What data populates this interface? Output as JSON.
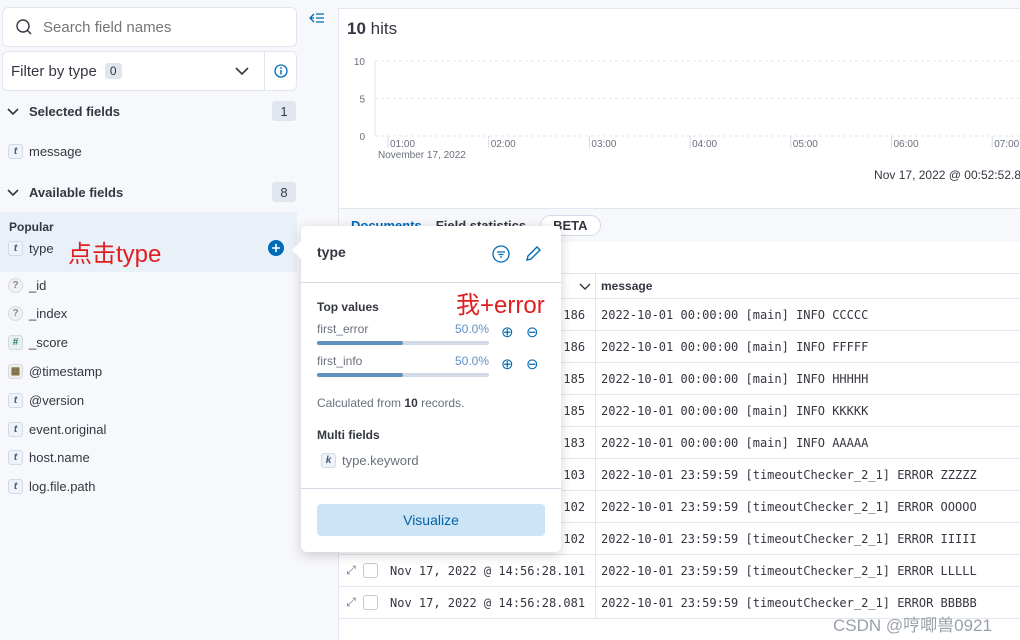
{
  "sidebar": {
    "search_placeholder": "Search field names",
    "filter_label": "Filter by type",
    "filter_count": "0",
    "selected_title": "Selected fields",
    "selected_count": "1",
    "selected_fields": [
      {
        "type": "t",
        "name": "message"
      }
    ],
    "available_title": "Available fields",
    "available_count": "8",
    "popular_title": "Popular",
    "popular_fields": [
      {
        "type": "t",
        "name": "type"
      }
    ],
    "fields": [
      {
        "type": "?",
        "name": "_id"
      },
      {
        "type": "?",
        "name": "_index"
      },
      {
        "type": "#",
        "name": "_score"
      },
      {
        "type": "date",
        "name": "@timestamp"
      },
      {
        "type": "t",
        "name": "@version"
      },
      {
        "type": "t",
        "name": "event.original"
      },
      {
        "type": "t",
        "name": "host.name"
      },
      {
        "type": "t",
        "name": "log.file.path"
      }
    ]
  },
  "annotations": {
    "click_type": "点击type",
    "me_error": "我+error"
  },
  "main": {
    "hits_count": "10",
    "hits_label": "hits",
    "chart": {
      "y_ticks": [
        "10",
        "5",
        "0"
      ],
      "x_ticks": [
        "01:00",
        "02:00",
        "03:00",
        "04:00",
        "05:00",
        "06:00",
        "07:00"
      ],
      "date_label": "November 17, 2022",
      "range_label": "Nov 17, 2022 @ 00:52:52.8"
    },
    "tabs": {
      "documents": "Documents",
      "field_stats": "Field statistics",
      "beta": "BETA"
    },
    "table": {
      "message_header": "message",
      "rows": [
        {
          "ts": "Nov 17, 2022 @ 14:56:28.186",
          "msg": "2022-10-01 00:00:00 [main] INFO CCCCC"
        },
        {
          "ts": "Nov 17, 2022 @ 14:56:28.186",
          "msg": "2022-10-01 00:00:00 [main] INFO FFFFF"
        },
        {
          "ts": "Nov 17, 2022 @ 14:56:28.185",
          "msg": "2022-10-01 00:00:00 [main] INFO HHHHH"
        },
        {
          "ts": "Nov 17, 2022 @ 14:56:28.185",
          "msg": "2022-10-01 00:00:00 [main] INFO KKKKK"
        },
        {
          "ts": "Nov 17, 2022 @ 14:56:28.183",
          "msg": "2022-10-01 00:00:00 [main] INFO AAAAA"
        },
        {
          "ts": "Nov 17, 2022 @ 14:56:28.103",
          "msg": "2022-10-01 23:59:59 [timeoutChecker_2_1] ERROR ZZZZZ"
        },
        {
          "ts": "Nov 17, 2022 @ 14:56:28.102",
          "msg": "2022-10-01 23:59:59 [timeoutChecker_2_1] ERROR OOOOO"
        },
        {
          "ts": "Nov 17, 2022 @ 14:56:28.102",
          "msg": "2022-10-01 23:59:59 [timeoutChecker_2_1] ERROR IIIII"
        },
        {
          "ts": "Nov 17, 2022 @ 14:56:28.101",
          "msg": "2022-10-01 23:59:59 [timeoutChecker_2_1] ERROR LLLLL"
        },
        {
          "ts": "Nov 17, 2022 @ 14:56:28.081",
          "msg": "2022-10-01 23:59:59 [timeoutChecker_2_1] ERROR BBBBB"
        }
      ]
    }
  },
  "popover": {
    "title": "type",
    "top_values_title": "Top values",
    "values": [
      {
        "label": "first_error",
        "pct": "50.0%",
        "fraction": 0.5
      },
      {
        "label": "first_info",
        "pct": "50.0%",
        "fraction": 0.5
      }
    ],
    "calc_prefix": "Calculated from",
    "calc_count": "10",
    "calc_suffix": "records.",
    "multi_title": "Multi fields",
    "multi_fields": [
      {
        "type": "k",
        "name": "type.keyword"
      }
    ],
    "visualize": "Visualize"
  },
  "watermark": "CSDN @哼唧兽0921"
}
